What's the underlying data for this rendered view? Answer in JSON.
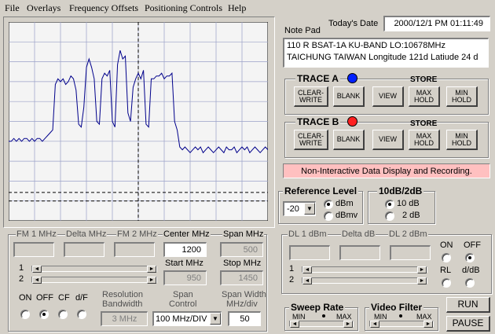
{
  "menu": {
    "file": "File",
    "overlays": "Overlays",
    "frequency_offsets": "Frequency Offsets",
    "positioning_controls": "Positioning Controls",
    "help": "Help"
  },
  "date": {
    "label": "Today's Date",
    "value": "2000/12/1 PM 01:11:49"
  },
  "notepad": {
    "label": "Note Pad",
    "line1": "110 R  BSAT-1A   KU-BAND     LO:10678MHz",
    "line2": "TAICHUNG  TAIWAN  Longitude 121d  Latiude  24 d"
  },
  "trace_a": {
    "title": "TRACE A",
    "store": "STORE",
    "color": "#0000ff"
  },
  "trace_b": {
    "title": "TRACE B",
    "store": "STORE",
    "color": "#ff0000"
  },
  "trace_buttons": {
    "clear_write_1": "CLEAR-",
    "clear_write_2": "WRITE",
    "blank": "BLANK",
    "view": "VIEW",
    "max_1": "MAX",
    "max_2": "HOLD",
    "min_1": "MIN",
    "min_2": "HOLD"
  },
  "status": {
    "text": "Non-Interactive Data Display and Recording.",
    "bg": "#ffc0c0"
  },
  "reference": {
    "title": "Reference Level",
    "value": "-20",
    "dbm": "dBm",
    "dbmv": "dBmv"
  },
  "scale": {
    "title": "10dB/2dB",
    "opt1": "10 dB",
    "opt2": "2 dB"
  },
  "freq": {
    "fm1": "FM 1 MHz",
    "delta": "Delta MHz",
    "fm2": "FM 2 MHz",
    "center_label": "Center MHz",
    "center_value": "1200",
    "span_label": "Span MHz",
    "span_value": "500",
    "start_label": "Start MHz",
    "start_value": "950",
    "stop_label": "Stop MHz",
    "stop_value": "1450",
    "row1": "1",
    "row2": "2",
    "on": "ON",
    "off": "OFF",
    "cf": "CF",
    "df": "d/F",
    "resbw_1": "Resolution",
    "resbw_2": "Bandwidth",
    "resbw_value": "3 MHz",
    "spanctl_1": "Span",
    "spanctl_2": "Control",
    "spanctl_value": "100 MHz/DIV",
    "spanwidth_1": "Span Width",
    "spanwidth_2": "MHz/div",
    "spanwidth_value": "50"
  },
  "dl": {
    "dl1": "DL 1  dBm",
    "delta": "Delta dB",
    "dl2": "DL 2  dBm",
    "row1": "1",
    "row2": "2",
    "on": "ON",
    "off": "OFF",
    "rl": "RL",
    "dd": "d/dB"
  },
  "sweep": {
    "title": "Sweep Rate",
    "min": "MIN",
    "max": "MAX"
  },
  "video": {
    "title": "Video Filter",
    "min": "MIN",
    "max": "MAX"
  },
  "run": "RUN",
  "pause": "PAUSE",
  "chart_data": {
    "type": "line",
    "x": [
      0,
      1,
      2,
      3,
      4,
      5,
      6,
      7,
      8,
      9,
      10,
      11,
      12,
      13,
      14,
      15,
      16,
      17,
      18,
      19,
      20,
      21,
      22,
      23,
      24,
      25,
      26,
      27,
      28,
      29,
      30,
      31,
      32,
      33,
      34,
      35,
      36,
      37,
      38,
      39,
      40,
      41,
      42,
      43,
      44,
      45,
      46,
      47,
      48,
      49,
      50,
      51,
      52,
      53,
      54,
      55,
      56,
      57,
      58,
      59,
      60,
      61,
      62,
      63,
      64,
      65,
      66,
      67,
      68,
      69,
      70,
      71,
      72,
      73,
      74,
      75,
      76,
      77,
      78,
      79,
      80,
      81,
      82,
      83,
      84,
      85,
      86,
      87,
      88,
      89,
      90,
      91,
      92,
      93,
      94,
      95,
      96,
      97,
      98,
      99,
      100
    ],
    "values": [
      -62,
      -62,
      -61,
      -62,
      -61,
      -62,
      -61,
      -61,
      -62,
      -61,
      -62,
      -61,
      -61,
      -62,
      -61,
      -60,
      -59,
      -58,
      -42,
      -40,
      -41,
      -40,
      -42,
      -41,
      -39,
      -40,
      -44,
      -56,
      -57,
      -50,
      -36,
      -33,
      -36,
      -40,
      -55,
      -56,
      -40,
      -38,
      -39,
      -37,
      -55,
      -57,
      -35,
      -30,
      -33,
      -32,
      -52,
      -55,
      -43,
      -40,
      -38,
      -40,
      -37,
      -56,
      -57,
      -40,
      -40,
      -39,
      -39,
      -38,
      -40,
      -39,
      -39,
      -38,
      -55,
      -58,
      -64,
      -65,
      -64,
      -65,
      -66,
      -65,
      -64,
      -65,
      -64,
      -66,
      -65,
      -64,
      -65,
      -66,
      -65,
      -64,
      -65,
      -66,
      -64,
      -65,
      -65,
      -64,
      -66,
      -65,
      -64,
      -65,
      -64,
      -66,
      -65,
      -64,
      -65,
      -66,
      -65,
      -64,
      -65
    ],
    "ylim": [
      -90,
      -20
    ],
    "grid": true,
    "display_lines": [
      -80,
      -83
    ],
    "center_marker": 50
  }
}
